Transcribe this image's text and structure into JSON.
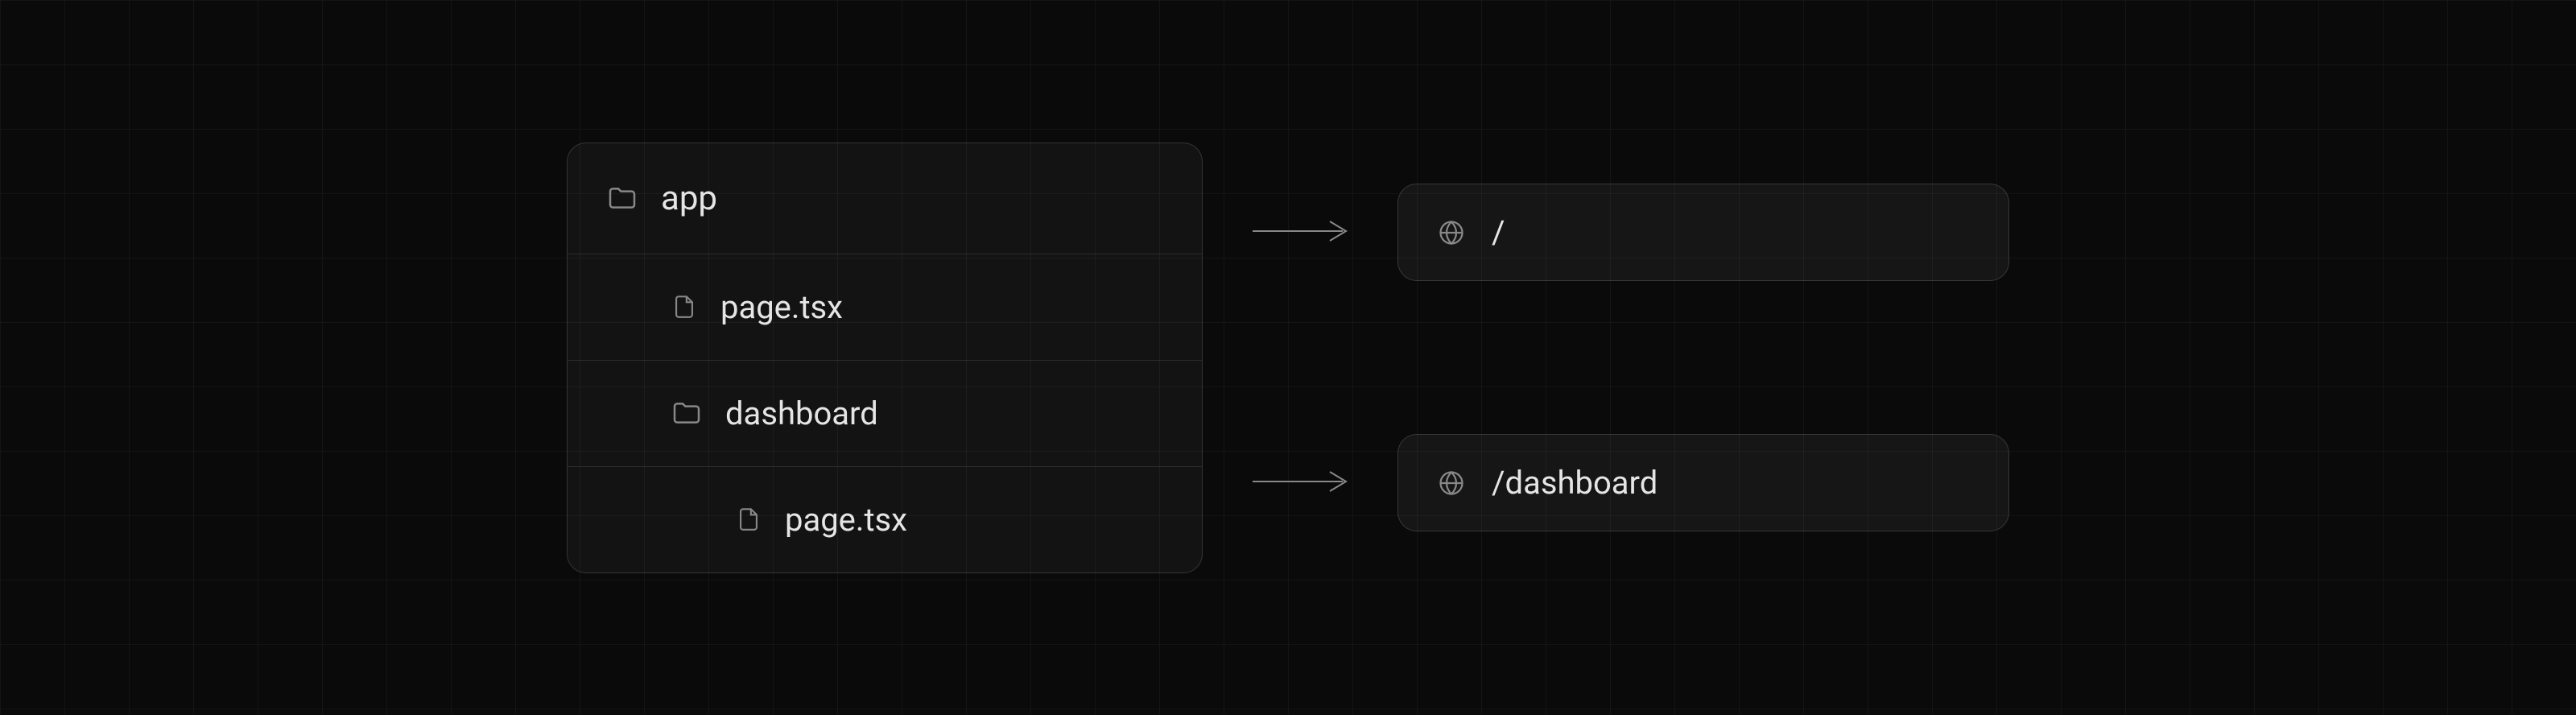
{
  "fileTree": {
    "root": "app",
    "items": [
      {
        "type": "file",
        "name": "page.tsx",
        "depth": 1
      },
      {
        "type": "folder",
        "name": "dashboard",
        "depth": 1
      },
      {
        "type": "file",
        "name": "page.tsx",
        "depth": 2
      }
    ]
  },
  "routes": [
    {
      "path": "/"
    },
    {
      "path": "/dashboard"
    }
  ]
}
